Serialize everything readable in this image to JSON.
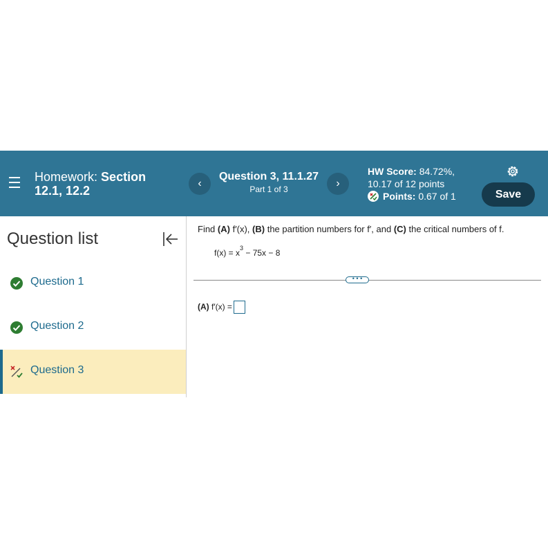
{
  "header": {
    "homework_prefix": "Homework:",
    "homework_section": "Section 12.1, 12.2",
    "question_title": "Question 3, 11.1.27",
    "question_part": "Part 1 of 3",
    "prev_glyph": "‹",
    "next_glyph": "›",
    "hw_score_label": "HW Score:",
    "hw_score_value": "84.72%,",
    "hw_points": "10.17 of 12 points",
    "points_label": "Points:",
    "points_value": "0.67 of 1",
    "save_label": "Save"
  },
  "sidebar": {
    "title": "Question list",
    "items": [
      {
        "label": "Question 1",
        "status": "correct"
      },
      {
        "label": "Question 2",
        "status": "correct"
      },
      {
        "label": "Question 3",
        "status": "partial"
      }
    ]
  },
  "content": {
    "find_word": "Find",
    "part_a": "(A)",
    "fprime_text": "f′(x),",
    "part_b": "(B)",
    "partition_text": "the partition numbers for f′, and",
    "part_c": "(C)",
    "critical_text": "the critical numbers of f.",
    "function_lhs": "f(x) = x",
    "function_exp": "3",
    "function_rhs": " − 75x − 8",
    "divider_handle": "• • •",
    "answer_label": "(A)",
    "answer_expr": "f′(x) ="
  },
  "colors": {
    "header_bg": "#2f7595",
    "save_bg": "#163a4c",
    "link": "#1d6a8d",
    "active_row": "#fbedbd",
    "correct": "#2e7d32"
  }
}
